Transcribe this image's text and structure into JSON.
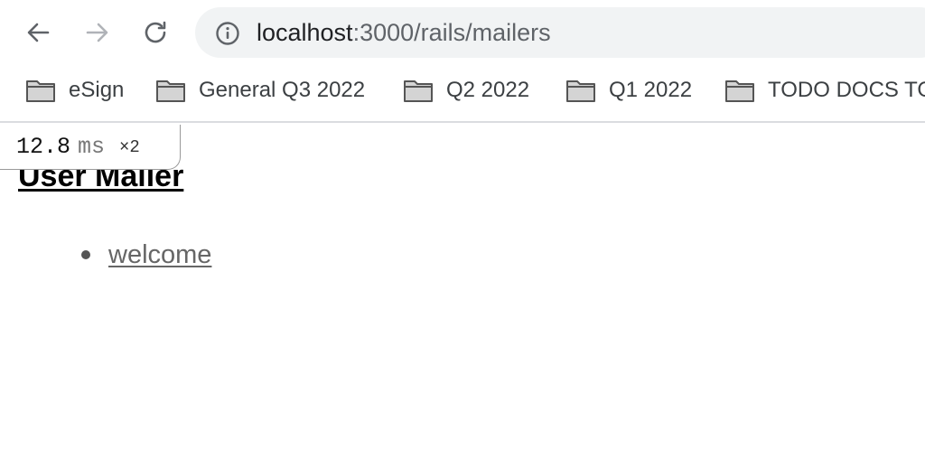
{
  "browser": {
    "url_host": "localhost",
    "url_path": ":3000/rails/mailers",
    "icons": {
      "back": "arrow-left-icon",
      "forward": "arrow-right-icon",
      "reload": "reload-icon",
      "site_info": "info-icon"
    }
  },
  "bookmarks": [
    {
      "label": "eSign",
      "icon": "folder-icon"
    },
    {
      "label": "General Q3 2022",
      "icon": "folder-icon"
    },
    {
      "label": "Q2 2022",
      "icon": "folder-icon"
    },
    {
      "label": "Q1 2022",
      "icon": "folder-icon"
    },
    {
      "label": "TODO DOCS TO",
      "icon": "folder-icon"
    }
  ],
  "profiler": {
    "value": "12.8",
    "unit": "ms",
    "count": "×2"
  },
  "page": {
    "heading": "User Mailer",
    "mailers": [
      {
        "label": "welcome"
      }
    ]
  },
  "colors": {
    "omnibox_bg": "#f1f3f4",
    "link": "#666666",
    "heading": "#000000"
  }
}
